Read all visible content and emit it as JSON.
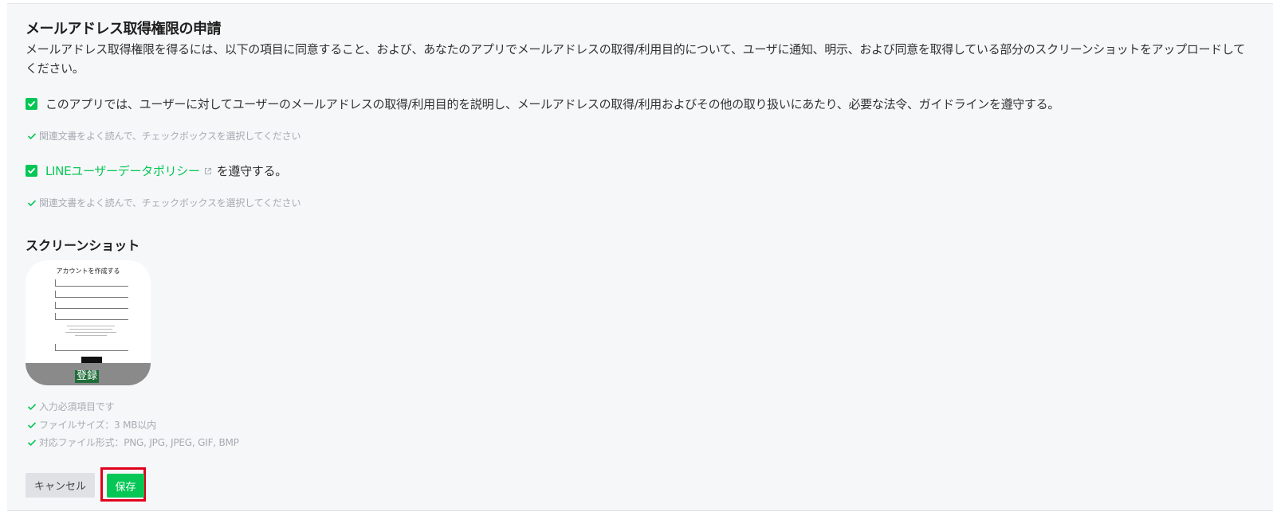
{
  "section": {
    "title": "メールアドレス取得権限の申請",
    "description": "メールアドレス取得権限を得るには、以下の項目に同意すること、および、あなたのアプリでメールアドレスの取得/利用目的について、ユーザに通知、明示、および同意を取得している部分のスクリーンショットをアップロードしてください。"
  },
  "agreements": [
    {
      "checked": true,
      "text": "このアプリでは、ユーザーに対してユーザーのメールアドレスの取得/利用目的を説明し、メールアドレスの取得/利用およびその他の取り扱いにあたり、必要な法令、ガイドラインを遵守する。",
      "hint": "関連文書をよく読んで、チェックボックスを選択してください"
    },
    {
      "checked": true,
      "link_text": "LINEユーザーデータポリシー",
      "suffix": "を遵守する。",
      "hint": "関連文書をよく読んで、チェックボックスを選択してください"
    }
  ],
  "screenshot": {
    "heading": "スクリーンショット",
    "preview_title": "アカウントを作成する",
    "preview_button": "登録",
    "hints": [
      "入力必須項目です",
      "ファイルサイズ：3 MB以内",
      "対応ファイル形式：PNG, JPG, JPEG, GIF, BMP"
    ]
  },
  "actions": {
    "cancel_label": "キャンセル",
    "save_label": "保存"
  },
  "colors": {
    "accent": "#06c755",
    "highlight": "#e1001c",
    "hint": "#a6abb1"
  },
  "icons": [
    "check-icon",
    "external-link-icon"
  ]
}
